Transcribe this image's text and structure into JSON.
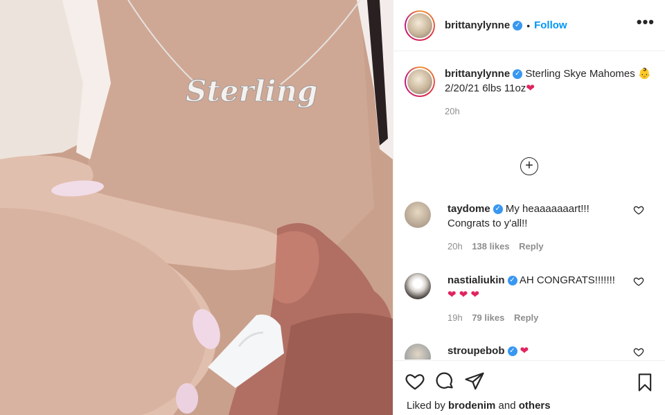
{
  "post": {
    "username": "brittanylynne",
    "follow_label": "Follow",
    "separator": "•",
    "more_label": "•••"
  },
  "caption": {
    "username": "brittanylynne",
    "text_line1": "Sterling Skye Mahomes",
    "text_line2": "2/20/21 6lbs 11oz",
    "time": "20h"
  },
  "necklace_text": "Sterling",
  "comments": [
    {
      "username": "taydome",
      "text": "My heaaaaaaart!!! Congrats to y'all!!",
      "time": "20h",
      "likes": "138 likes",
      "reply": "Reply"
    },
    {
      "username": "nastialiukin",
      "text": "AH CONGRATS!!!!!!!",
      "time": "19h",
      "likes": "79 likes",
      "reply": "Reply"
    },
    {
      "username": "stroupebob",
      "text": "",
      "time": "",
      "likes": "",
      "reply": ""
    }
  ],
  "footer": {
    "liked_prefix": "Liked by ",
    "liked_user": "brodenim",
    "liked_and": " and ",
    "liked_others": "others"
  },
  "colors": {
    "accent": "#0095f6",
    "verified": "#3897f0",
    "heart": "#e0245e",
    "muted": "#8e8e8e"
  }
}
